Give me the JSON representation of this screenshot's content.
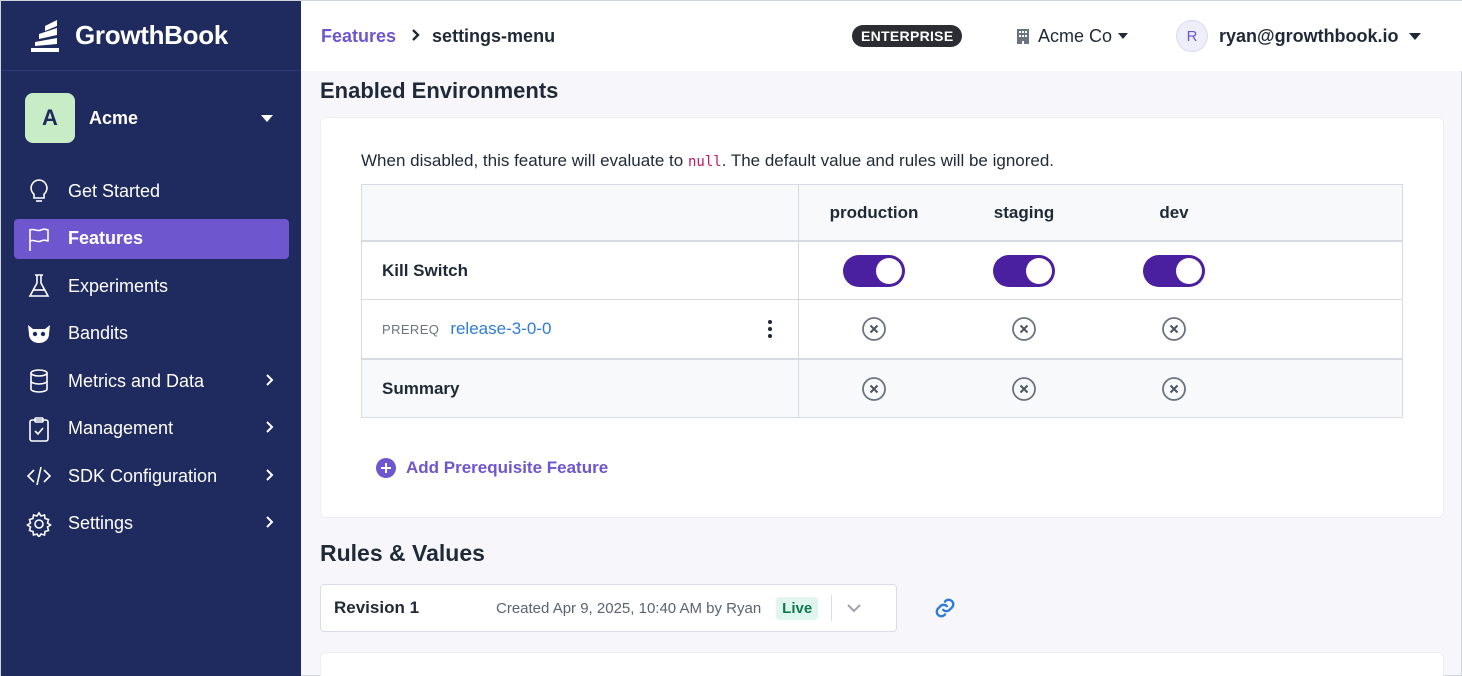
{
  "brand": {
    "name": "GrowthBook"
  },
  "org": {
    "initial": "A",
    "name": "Acme"
  },
  "nav": [
    {
      "label": "Get Started",
      "icon": "lightbulb-icon"
    },
    {
      "label": "Features",
      "icon": "flag-icon",
      "active": true
    },
    {
      "label": "Experiments",
      "icon": "flask-icon"
    },
    {
      "label": "Bandits",
      "icon": "raccoon-icon"
    },
    {
      "label": "Metrics and Data",
      "icon": "database-icon",
      "chevron": true
    },
    {
      "label": "Management",
      "icon": "clipboard-check-icon",
      "chevron": true
    },
    {
      "label": "SDK Configuration",
      "icon": "code-icon",
      "chevron": true
    },
    {
      "label": "Settings",
      "icon": "gear-icon",
      "chevron": true
    }
  ],
  "topbar": {
    "breadcrumb_parent": "Features",
    "breadcrumb_current": "settings-menu",
    "plan_badge": "ENTERPRISE",
    "org_switch": "Acme Co",
    "user_initial": "R",
    "user_email": "ryan@growthbook.io"
  },
  "environments": {
    "title": "Enabled Environments",
    "description_prefix": "When disabled, this feature will evaluate to ",
    "description_code": "null",
    "description_suffix": ". The default value and rules will be ignored.",
    "columns": [
      "production",
      "staging",
      "dev"
    ],
    "kill_switch_label": "Kill Switch",
    "kill_switch_states": [
      true,
      true,
      true
    ],
    "prereq_tag": "PREREQ",
    "prereq_name": "release-3-0-0",
    "summary_label": "Summary",
    "add_prereq_label": "Add Prerequisite Feature"
  },
  "rules": {
    "title": "Rules & Values",
    "revision_title": "Revision 1",
    "revision_created": "Created Apr 9, 2025, 10:40 AM by Ryan",
    "revision_status": "Live"
  },
  "colors": {
    "sidebar": "#1f2a5e",
    "accent": "#6e56cf",
    "toggle_on": "#4a1fa0",
    "link": "#2f7bd9"
  }
}
